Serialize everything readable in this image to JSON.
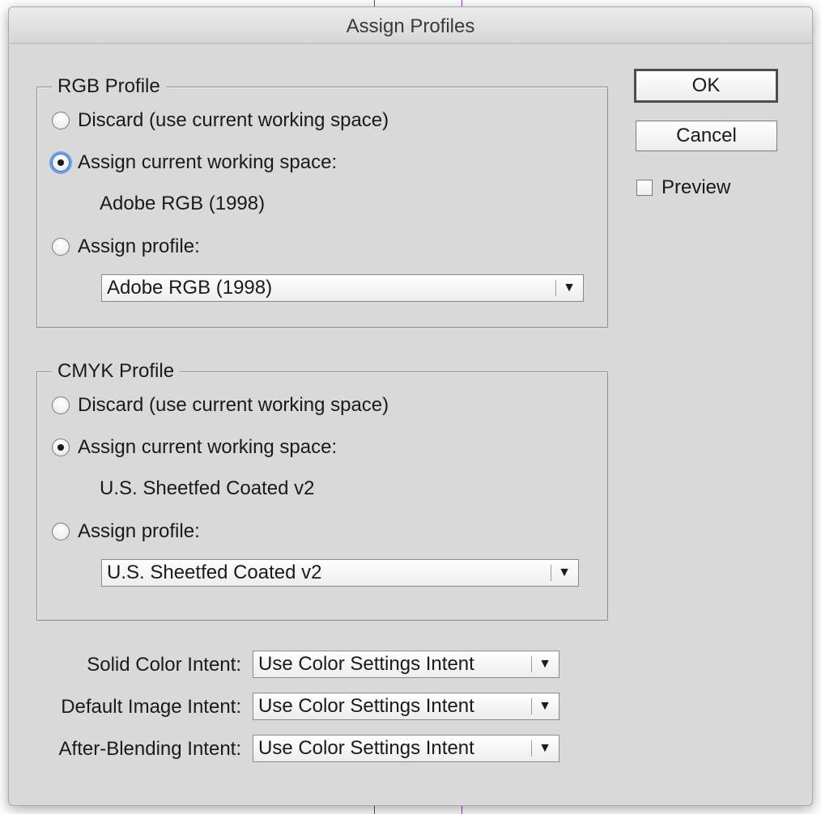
{
  "dialog": {
    "title": "Assign Profiles"
  },
  "rgb": {
    "legend": "RGB Profile",
    "options": [
      {
        "label": "Discard (use current working space)",
        "checked": false
      },
      {
        "label": "Assign current working space:",
        "checked": true
      },
      {
        "label": "Assign profile:",
        "checked": false
      }
    ],
    "working_space": "Adobe RGB (1998)",
    "profile_select": "Adobe RGB (1998)"
  },
  "cmyk": {
    "legend": "CMYK Profile",
    "options": [
      {
        "label": "Discard (use current working space)",
        "checked": false
      },
      {
        "label": "Assign current working space:",
        "checked": true
      },
      {
        "label": "Assign profile:",
        "checked": false
      }
    ],
    "working_space": "U.S. Sheetfed Coated v2",
    "profile_select": "U.S. Sheetfed Coated v2"
  },
  "intents": {
    "solid_label": "Solid Color Intent:",
    "solid_value": "Use Color Settings Intent",
    "image_label": "Default Image Intent:",
    "image_value": "Use Color Settings Intent",
    "blending_label": "After-Blending Intent:",
    "blending_value": "Use Color Settings Intent"
  },
  "buttons": {
    "ok": "OK",
    "cancel": "Cancel",
    "preview": "Preview",
    "preview_checked": false
  },
  "icons": {
    "dropdown": "▼"
  },
  "colors": {
    "dialog_bg": "#d9d9d9",
    "focus_ring": "#6aa0e6",
    "background_line": "#8e3fb0"
  }
}
